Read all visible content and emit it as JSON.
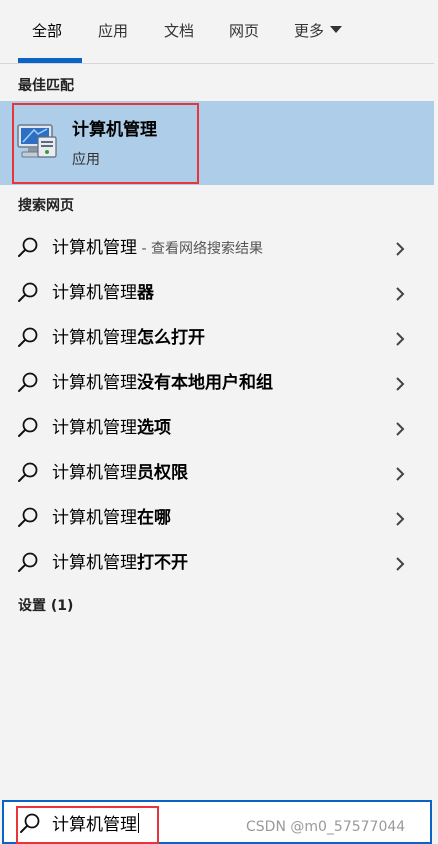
{
  "tabs": [
    {
      "label": "全部",
      "active": true
    },
    {
      "label": "应用",
      "active": false
    },
    {
      "label": "文档",
      "active": false
    },
    {
      "label": "网页",
      "active": false
    },
    {
      "label": "更多",
      "active": false
    }
  ],
  "sections": {
    "best_match": "最佳匹配",
    "search_web": "搜索网页",
    "settings": "设置 (1)"
  },
  "best_match": {
    "title": "计算机管理",
    "subtitle": "应用",
    "icon": "computer-management-icon"
  },
  "results": [
    {
      "prefix": "计算机管理",
      "bold": "",
      "suffix": " - 查看网络搜索结果"
    },
    {
      "prefix": "计算机管理",
      "bold": "器",
      "suffix": ""
    },
    {
      "prefix": "计算机管理",
      "bold": "怎么打开",
      "suffix": ""
    },
    {
      "prefix": "计算机管理",
      "bold": "没有本地用户和组",
      "suffix": ""
    },
    {
      "prefix": "计算机管理",
      "bold": "选项",
      "suffix": ""
    },
    {
      "prefix": "计算机管理",
      "bold": "员权限",
      "suffix": ""
    },
    {
      "prefix": "计算机管理",
      "bold": "在哪",
      "suffix": ""
    },
    {
      "prefix": "计算机管理",
      "bold": "打不开",
      "suffix": ""
    }
  ],
  "search": {
    "value": "计算机管理"
  },
  "watermark": "CSDN @m0_57577044",
  "colors": {
    "accent": "#0a64c8",
    "highlight": "#aecde9",
    "annotation_red": "#e8353b",
    "background": "#f3f3f3"
  }
}
